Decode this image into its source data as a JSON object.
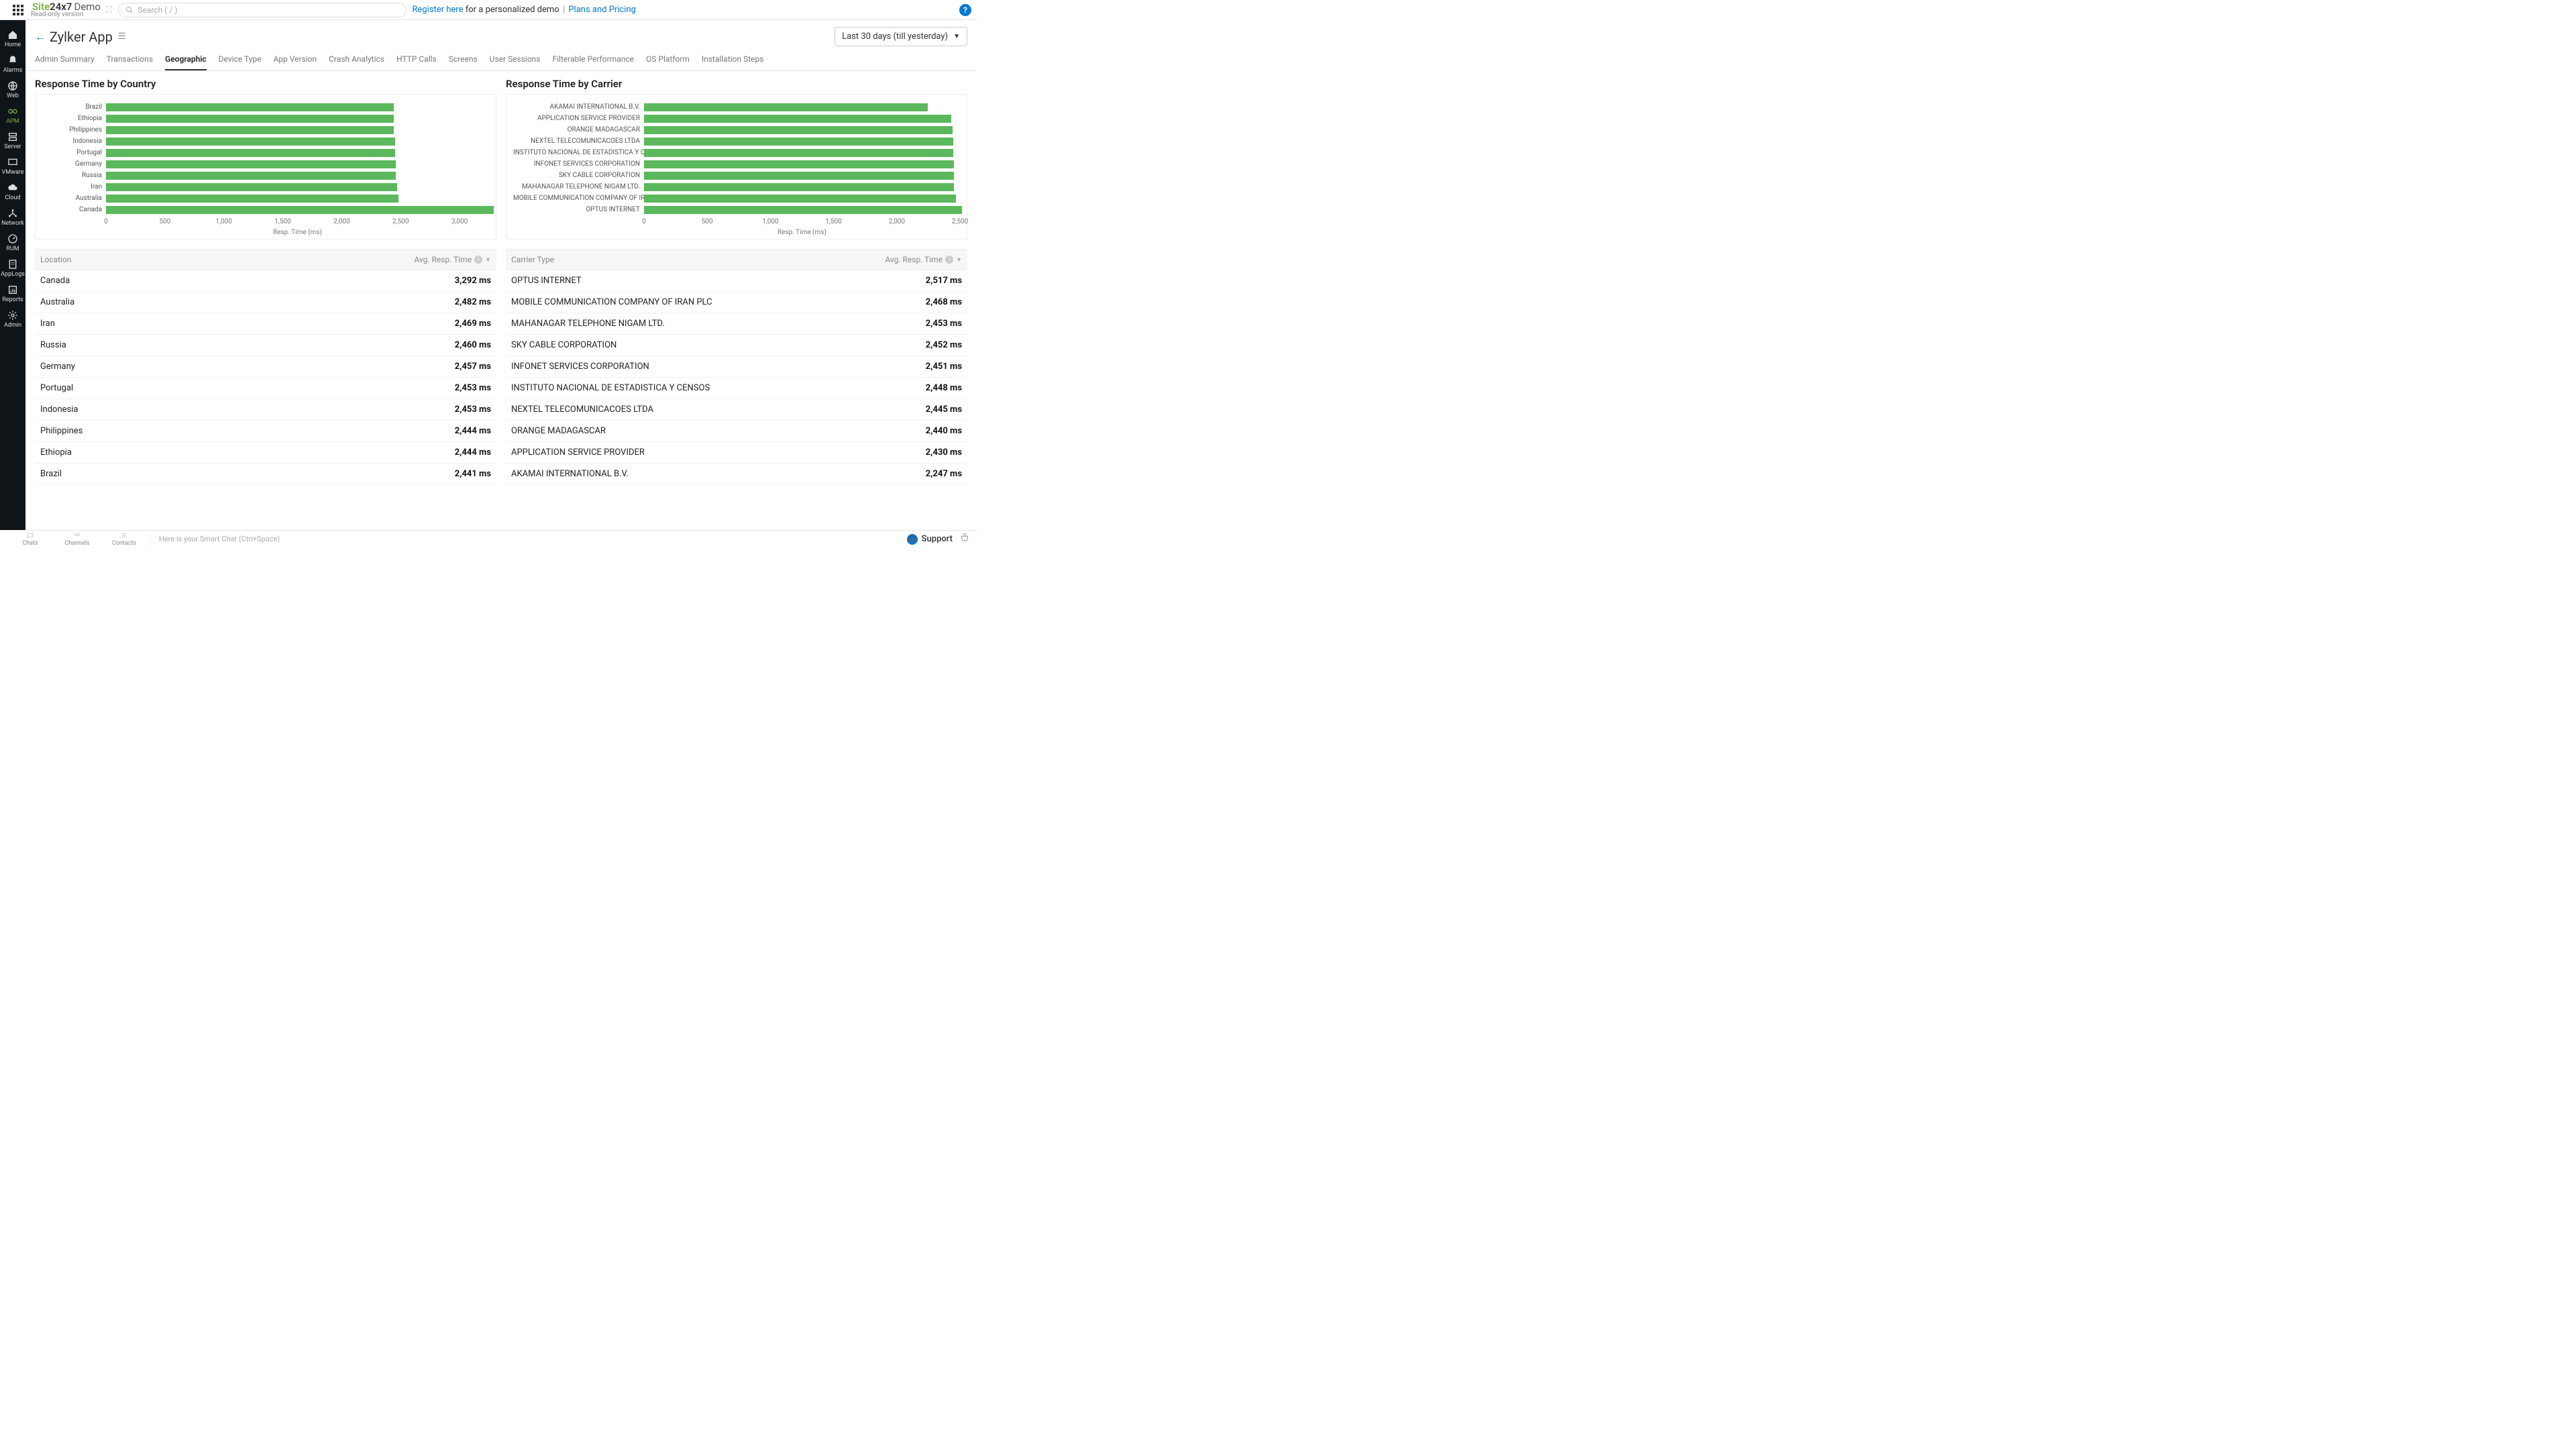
{
  "header": {
    "logo_site": "Site",
    "logo_24x7": "24x7",
    "logo_demo": "Demo",
    "logo_sub": "Read-only version",
    "search_placeholder": "Search ( / )",
    "register": "Register here",
    "register_suffix": " for a personalized demo ",
    "plans": "Plans and Pricing"
  },
  "sidebar": [
    {
      "label": "Home",
      "icon": "home"
    },
    {
      "label": "Alarms",
      "icon": "bell"
    },
    {
      "label": "Web",
      "icon": "globe"
    },
    {
      "label": "APM",
      "icon": "apm",
      "active": true
    },
    {
      "label": "Server",
      "icon": "server"
    },
    {
      "label": "VMware",
      "icon": "vmware"
    },
    {
      "label": "Cloud",
      "icon": "cloud"
    },
    {
      "label": "Network",
      "icon": "network"
    },
    {
      "label": "RUM",
      "icon": "rum"
    },
    {
      "label": "AppLogs",
      "icon": "logs"
    },
    {
      "label": "Reports",
      "icon": "reports"
    },
    {
      "label": "Admin",
      "icon": "gear"
    }
  ],
  "page": {
    "title": "Zylker App",
    "time_range": "Last 30 days (till yesterday)"
  },
  "tabs": [
    {
      "label": "Admin Summary"
    },
    {
      "label": "Transactions"
    },
    {
      "label": "Geographic",
      "active": true
    },
    {
      "label": "Device Type"
    },
    {
      "label": "App Version"
    },
    {
      "label": "Crash Analytics"
    },
    {
      "label": "HTTP Calls"
    },
    {
      "label": "Screens"
    },
    {
      "label": "User Sessions"
    },
    {
      "label": "Filterable Performance"
    },
    {
      "label": "OS Platform"
    },
    {
      "label": "Installation Steps"
    }
  ],
  "chart_data": [
    {
      "type": "bar",
      "title": "Response Time by Country",
      "xlabel": "Resp. Time (ms)",
      "xlim": [
        0,
        3250
      ],
      "ticks": [
        0,
        500,
        1000,
        1500,
        2000,
        2500,
        3000
      ],
      "tick_labels": [
        "0",
        "500",
        "1,000",
        "1,500",
        "2,000",
        "2,500",
        "3,000"
      ],
      "categories": [
        "Brazil",
        "Ethiopia",
        "Philippines",
        "Indonesia",
        "Portugal",
        "Germany",
        "Russia",
        "Iran",
        "Australia",
        "Canada"
      ],
      "values": [
        2441,
        2444,
        2444,
        2453,
        2453,
        2457,
        2460,
        2469,
        2482,
        3292
      ]
    },
    {
      "type": "bar",
      "title": "Response Time by Carrier",
      "xlabel": "Resp. Time (ms)",
      "xlim": [
        0,
        2500
      ],
      "ticks": [
        0,
        500,
        1000,
        1500,
        2000,
        2500
      ],
      "tick_labels": [
        "0",
        "500",
        "1,000",
        "1,500",
        "2,000",
        "2,500"
      ],
      "categories": [
        "AKAMAI INTERNATIONAL B.V.",
        "APPLICATION SERVICE PROVIDER",
        "ORANGE MADAGASCAR",
        "NEXTEL TELECOMUNICACOES LTDA",
        "INSTITUTO NACIONAL DE ESTADISTICA Y CENSOS",
        "INFONET SERVICES CORPORATION",
        "SKY CABLE CORPORATION",
        "MAHANAGAR TELEPHONE NIGAM LTD.",
        "MOBILE COMMUNICATION COMPANY OF IRAN PLC",
        "OPTUS INTERNET"
      ],
      "values": [
        2247,
        2430,
        2440,
        2445,
        2448,
        2451,
        2452,
        2453,
        2468,
        2517
      ]
    }
  ],
  "tables": {
    "country": {
      "col1": "Location",
      "col2": "Avg. Resp. Time",
      "rows": [
        {
          "name": "Canada",
          "value": "3,292 ms"
        },
        {
          "name": "Australia",
          "value": "2,482 ms"
        },
        {
          "name": "Iran",
          "value": "2,469 ms"
        },
        {
          "name": "Russia",
          "value": "2,460 ms"
        },
        {
          "name": "Germany",
          "value": "2,457 ms"
        },
        {
          "name": "Portugal",
          "value": "2,453 ms"
        },
        {
          "name": "Indonesia",
          "value": "2,453 ms"
        },
        {
          "name": "Philippines",
          "value": "2,444 ms"
        },
        {
          "name": "Ethiopia",
          "value": "2,444 ms"
        },
        {
          "name": "Brazil",
          "value": "2,441 ms"
        }
      ]
    },
    "carrier": {
      "col1": "Carrier Type",
      "col2": "Avg. Resp. Time",
      "rows": [
        {
          "name": "OPTUS INTERNET",
          "value": "2,517 ms"
        },
        {
          "name": "MOBILE COMMUNICATION COMPANY OF IRAN PLC",
          "value": "2,468 ms"
        },
        {
          "name": "MAHANAGAR TELEPHONE NIGAM LTD.",
          "value": "2,453 ms"
        },
        {
          "name": "SKY CABLE CORPORATION",
          "value": "2,452 ms"
        },
        {
          "name": "INFONET SERVICES CORPORATION",
          "value": "2,451 ms"
        },
        {
          "name": "INSTITUTO NACIONAL DE ESTADISTICA Y CENSOS",
          "value": "2,448 ms"
        },
        {
          "name": "NEXTEL TELECOMUNICACOES LTDA",
          "value": "2,445 ms"
        },
        {
          "name": "ORANGE MADAGASCAR",
          "value": "2,440 ms"
        },
        {
          "name": "APPLICATION SERVICE PROVIDER",
          "value": "2,430 ms"
        },
        {
          "name": "AKAMAI INTERNATIONAL B.V.",
          "value": "2,247 ms"
        }
      ]
    }
  },
  "footer": {
    "chats": "Chats",
    "channels": "Channels",
    "contacts": "Contacts",
    "smart_chat": "Here is your Smart Chat (Ctrl+Space)",
    "support": "Support"
  }
}
